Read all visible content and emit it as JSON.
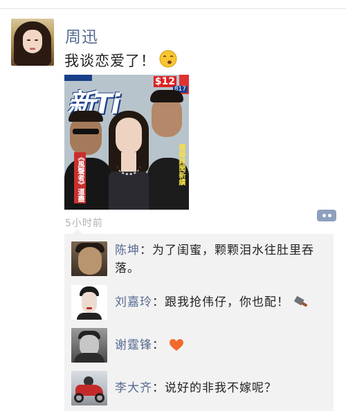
{
  "post": {
    "author": "周迅",
    "text": "我谈恋爱了！",
    "emoji": "smirk-face-icon",
    "timestamp": "5小时前",
    "image": {
      "magazine_title": "新Ti",
      "price": "$12",
      "issue": "817",
      "coverline_left": "《風聲者》道盡",
      "coverline_right": "霆鋒緋聞新績"
    }
  },
  "comments": [
    {
      "name": "陈坤",
      "separator": "：",
      "text": "为了闺蜜，颗颗泪水往肚里吞落。",
      "emoji": null
    },
    {
      "name": "刘嘉玲",
      "separator": "：",
      "text": "跟我抢伟仔，你也配！",
      "emoji": "cleaver-knife-icon"
    },
    {
      "name": "谢霆锋",
      "separator": "：",
      "text": "",
      "emoji": "orange-heart-icon"
    },
    {
      "name": "李大齐",
      "separator": "：",
      "text": "说好的非我不嫁呢？",
      "emoji": null
    }
  ],
  "colors": {
    "name_link": "#566a91",
    "timestamp": "#b0b0b0",
    "comment_bg": "#f2f2f2",
    "comment_button": "#8ea0bf",
    "heart": "#f26a2e"
  }
}
